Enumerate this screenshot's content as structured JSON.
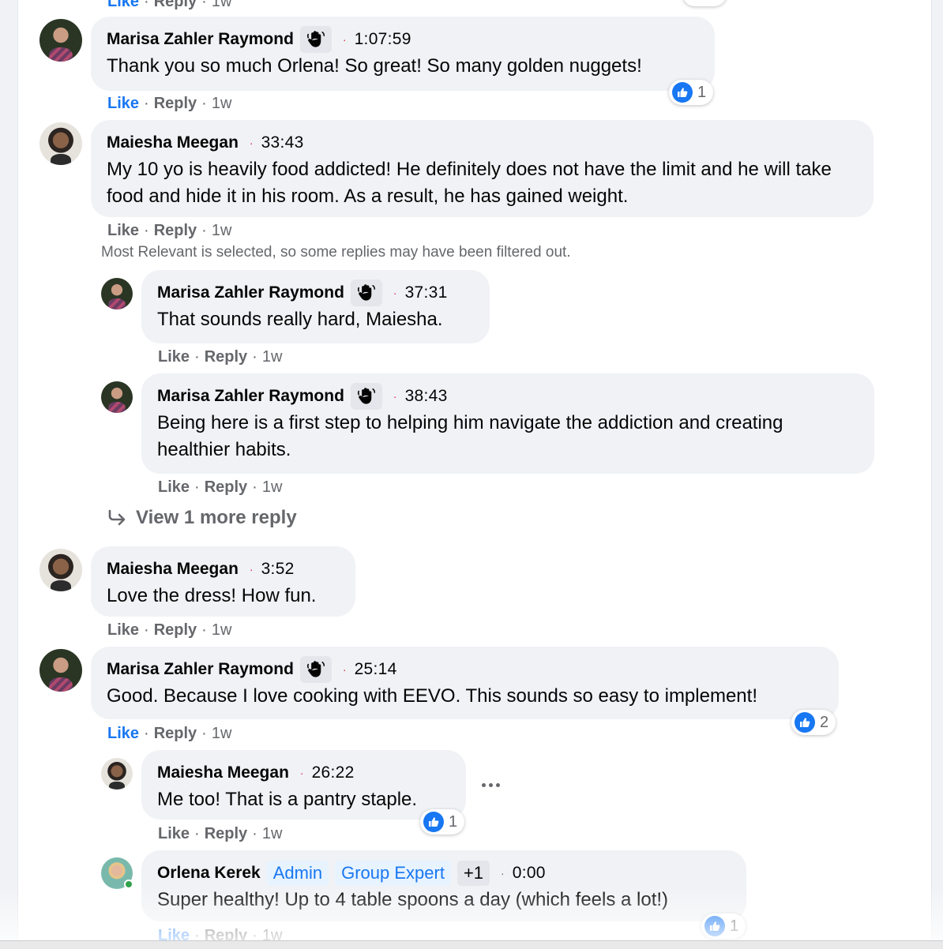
{
  "colors": {
    "bubble": "#f0f2f5",
    "link_blue": "#1877f2",
    "meta_grey": "#65676b",
    "badge_red_dot": "#e41e3f"
  },
  "top_partial": {
    "like": "Like",
    "reply": "Reply",
    "age": "1w"
  },
  "c1": {
    "author": "Marisa Zahler Raymond",
    "badge_icon": "hand-wave-icon",
    "timestamp": "1:07:59",
    "text": "Thank you so much Orlena! So great! So many golden nuggets!",
    "reaction_count": "1",
    "like": "Like",
    "reply": "Reply",
    "age": "1w"
  },
  "c2": {
    "author": "Maiesha Meegan",
    "timestamp": "33:43",
    "text": "My 10 yo is heavily food addicted! He definitely does not have the limit and he will take food and hide it in his room. As a result, he has gained weight.",
    "like": "Like",
    "reply": "Reply",
    "age": "1w"
  },
  "filter_notice": "Most Relevant is selected, so some replies may have been filtered out.",
  "r1": {
    "author": "Marisa Zahler Raymond",
    "badge_icon": "hand-wave-icon",
    "timestamp": "37:31",
    "text": "That sounds really hard, Maiesha.",
    "like": "Like",
    "reply": "Reply",
    "age": "1w"
  },
  "r2": {
    "author": "Marisa Zahler Raymond",
    "badge_icon": "hand-wave-icon",
    "timestamp": "38:43",
    "text": "Being here is a first step to helping him navigate the addiction and creating healthier habits.",
    "like": "Like",
    "reply": "Reply",
    "age": "1w"
  },
  "view_more": "View 1 more reply",
  "c3": {
    "author": "Maiesha Meegan",
    "timestamp": "3:52",
    "text": "Love the dress! How fun.",
    "like": "Like",
    "reply": "Reply",
    "age": "1w"
  },
  "c4": {
    "author": "Marisa Zahler Raymond",
    "badge_icon": "hand-wave-icon",
    "timestamp": "25:14",
    "text": "Good. Because I love cooking with EEVO. This sounds so easy to implement!",
    "reaction_count": "2",
    "like": "Like",
    "reply": "Reply",
    "age": "1w"
  },
  "r3": {
    "author": "Maiesha Meegan",
    "timestamp": "26:22",
    "text": "Me too! That is a pantry staple.",
    "reaction_count": "1",
    "like": "Like",
    "reply": "Reply",
    "age": "1w"
  },
  "r4": {
    "author": "Orlena Kerek",
    "tags": [
      "Admin",
      "Group Expert",
      "+1"
    ],
    "timestamp": "0:00",
    "text": "Super healthy! Up to 4 table spoons a day (which feels a lot!)",
    "reaction_count": "1",
    "like": "Like",
    "reply": "Reply",
    "age": "1w"
  }
}
